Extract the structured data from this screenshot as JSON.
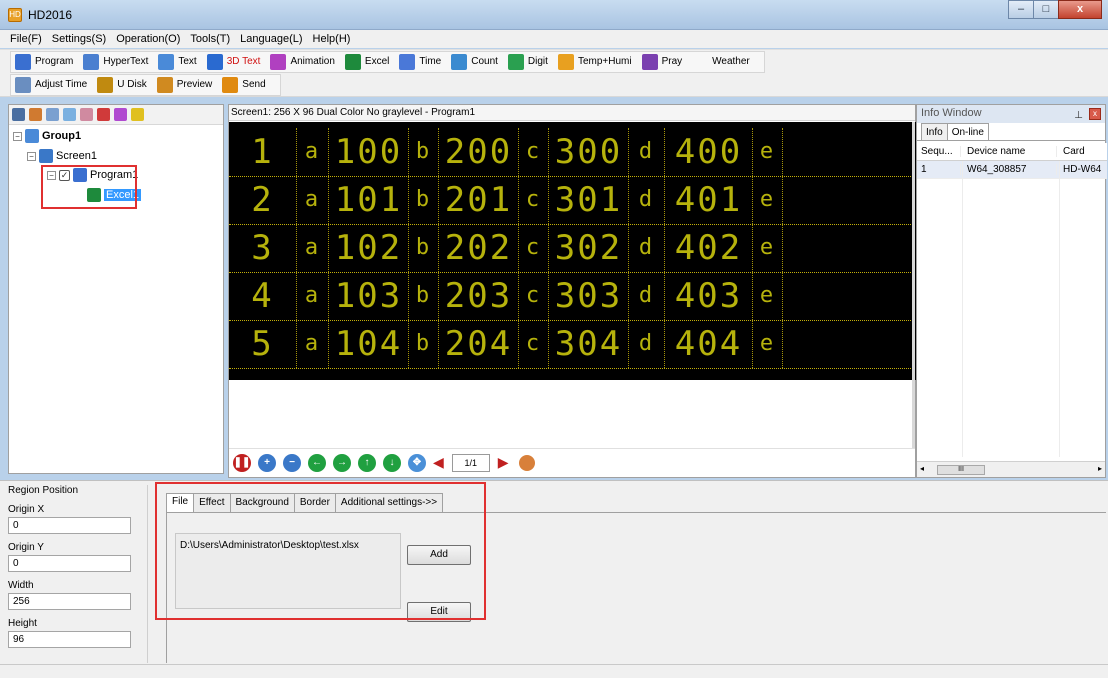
{
  "window": {
    "title": "HD2016",
    "app_icon_label": "HD",
    "controls": {
      "minimize": "–",
      "maximize": "□",
      "close": "x"
    }
  },
  "menubar": {
    "items": [
      "File(F)",
      "Settings(S)",
      "Operation(O)",
      "Tools(T)",
      "Language(L)",
      "Help(H)"
    ]
  },
  "toolbar1": {
    "items": [
      {
        "label": "Program",
        "icon": "program-icon",
        "color": "#3a6fd0"
      },
      {
        "label": "HyperText",
        "icon": "hypertext-icon",
        "color": "#4a7fd0"
      },
      {
        "label": "Text",
        "icon": "text-icon",
        "color": "#4a8ad8"
      },
      {
        "label": "3D Text",
        "icon": "3d-text-icon",
        "color": "#2a6ad0"
      },
      {
        "label": "Animation",
        "icon": "animation-icon",
        "color": "#b040c0"
      },
      {
        "label": "Excel",
        "icon": "excel-icon",
        "color": "#1e8a3c"
      },
      {
        "label": "Time",
        "icon": "time-icon",
        "color": "#4a78d8"
      },
      {
        "label": "Count",
        "icon": "count-icon",
        "color": "#3a8ad0"
      },
      {
        "label": "Digit",
        "icon": "digit-icon",
        "color": "#2aa050"
      },
      {
        "label": "Temp+Humi",
        "icon": "temp-humi-icon",
        "color": "#e8a020"
      },
      {
        "label": "Pray",
        "icon": "pray-icon",
        "color": "#7a40b0"
      },
      {
        "label": "Weather",
        "icon": "weather-icon",
        "color": "#f0f0f0"
      }
    ]
  },
  "toolbar2": {
    "items": [
      {
        "label": "Adjust Time",
        "icon": "adjust-time-icon",
        "color": "#6a8ec0"
      },
      {
        "label": "U Disk",
        "icon": "u-disk-icon",
        "color": "#c08a10"
      },
      {
        "label": "Preview",
        "icon": "preview-icon",
        "color": "#d08a20"
      },
      {
        "label": "Send",
        "icon": "send-icon",
        "color": "#e08a10"
      }
    ]
  },
  "tree": {
    "toolbar_icons": [
      {
        "name": "save-icon",
        "color": "#4a6ea0"
      },
      {
        "name": "add-group-icon",
        "color": "#d07a30"
      },
      {
        "name": "copy-icon",
        "color": "#7aa0d0"
      },
      {
        "name": "move-up-icon",
        "color": "#7ab0e0"
      },
      {
        "name": "move-down-icon",
        "color": "#d08aa0"
      },
      {
        "name": "delete-icon",
        "color": "#d03a3a"
      },
      {
        "name": "check-icon",
        "color": "#b04ad0"
      },
      {
        "name": "search-icon",
        "color": "#e0c020"
      }
    ],
    "group": "Group1",
    "screen": "Screen1",
    "program": "Program1",
    "excel": "Excel1"
  },
  "canvas": {
    "header": "Screen1: 256 X 96  Dual Color No graylevel - Program1",
    "led_rows": [
      [
        "1",
        "a",
        "100",
        "b",
        "200",
        "c",
        "300",
        "d",
        "400",
        "e"
      ],
      [
        "2",
        "a",
        "101",
        "b",
        "201",
        "c",
        "301",
        "d",
        "401",
        "e"
      ],
      [
        "3",
        "a",
        "102",
        "b",
        "202",
        "c",
        "302",
        "d",
        "402",
        "e"
      ],
      [
        "4",
        "a",
        "103",
        "b",
        "203",
        "c",
        "303",
        "d",
        "403",
        "e"
      ],
      [
        "5",
        "a",
        "104",
        "b",
        "204",
        "c",
        "304",
        "d",
        "404",
        "e"
      ]
    ],
    "page_indicator": "1/1",
    "controls": [
      {
        "name": "pause-icon",
        "glyph": "❚❚",
        "color": "#c02020"
      },
      {
        "name": "zoom-in-icon",
        "glyph": "+",
        "color": "#3a78c8"
      },
      {
        "name": "zoom-out-icon",
        "glyph": "−",
        "color": "#3a78c8"
      },
      {
        "name": "arrow-left-icon",
        "glyph": "←",
        "color": "#20a040"
      },
      {
        "name": "arrow-right-icon",
        "glyph": "→",
        "color": "#20a040"
      },
      {
        "name": "arrow-up-icon",
        "glyph": "↑",
        "color": "#20a040"
      },
      {
        "name": "arrow-down-icon",
        "glyph": "↓",
        "color": "#20a040"
      },
      {
        "name": "move-icon",
        "glyph": "✥",
        "color": "#4a90d8"
      }
    ]
  },
  "info_window": {
    "title": "Info Window",
    "pin": "⊥",
    "close": "x",
    "tabs": [
      "Info",
      "On-line"
    ],
    "columns": [
      "Sequ...",
      "Device name",
      "Card"
    ],
    "rows": [
      [
        "1",
        "W64_308857",
        "HD-W64"
      ]
    ],
    "scroll_thumb": "III"
  },
  "region": {
    "title": "Region Position",
    "origin_x_label": "Origin X",
    "origin_x": "0",
    "origin_y_label": "Origin Y",
    "origin_y": "0",
    "width_label": "Width",
    "width": "256",
    "height_label": "Height",
    "height": "96"
  },
  "properties": {
    "tabs": [
      "File",
      "Effect",
      "Background",
      "Border",
      "Additional settings->>"
    ],
    "file_path": "D:\\Users\\Administrator\\Desktop\\test.xlsx",
    "add_label": "Add",
    "edit_label": "Edit"
  }
}
